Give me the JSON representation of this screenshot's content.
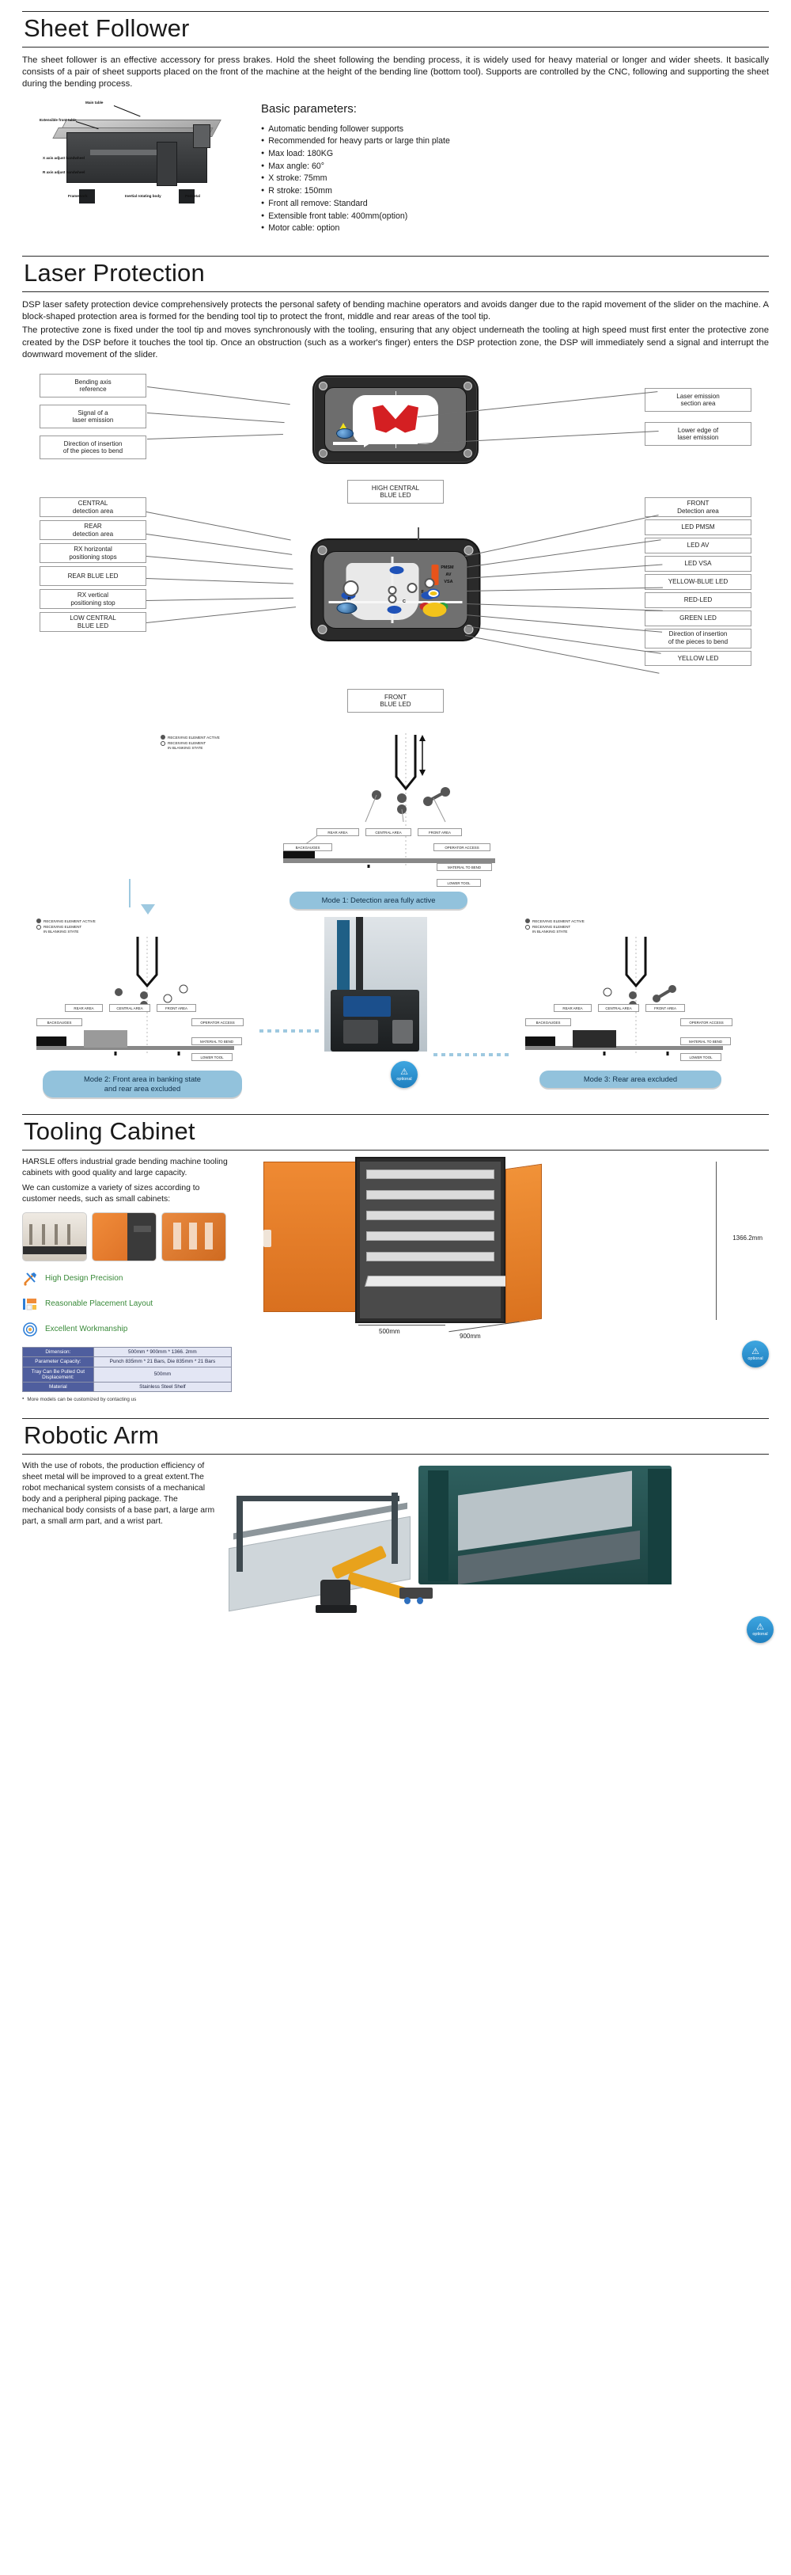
{
  "sections": {
    "sheet_follower": {
      "title": "Sheet Follower",
      "intro": "The sheet follower is an effective accessory for press brakes. Hold the sheet following the bending process, it is widely used for heavy material or longer and wider sheets. It basically consists of a pair of sheet supports placed on the front of the machine at the height of the bending line (bottom tool). Supports are controlled by the CNC, following and supporting the sheet during the bending process.",
      "params_title": "Basic parameters:",
      "params": [
        "Automatic bending follower supports",
        "Recommended for heavy parts or large thin plate",
        "Max load: 180KG",
        "Max angle: 60°",
        "X stroke: 75mm",
        "R stroke: 150mm",
        "Front all remove: Standard",
        "Extensible front table: 400mm(option)",
        "Motor cable: option"
      ],
      "image_labels": {
        "main_table": "Main table",
        "extensible_front_table": "Extensible front table",
        "x_axis": "X axis adjust handwheel",
        "r_axis": "R axis adjust handwheel",
        "framework": "Framework",
        "inertial_rotating_body": "Inertial rotating body",
        "pedestal": "Pedestal"
      }
    },
    "laser_protection": {
      "title": "Laser Protection",
      "paragraph1": "DSP laser safety protection device comprehensively protects the personal safety of bending machine operators and avoids danger due to the rapid movement of the slider on the machine. A block-shaped protection area is formed for the bending tool tip to protect the front, middle and rear areas of the tool tip.",
      "paragraph2": "The protective zone is fixed under the tool tip and moves synchronously with the tooling, ensuring that any object underneath the tooling at high speed must first enter the protective zone created by the DSP before it touches the tool tip. Once an obstruction (such as a worker's finger) enters the DSP protection zone, the DSP will immediately send a signal and interrupt the downward movement of the slider.",
      "diagram1": {
        "left": [
          "Bending axis\nreference",
          "Signal of a\nlaser emission",
          "Direction of insertion\nof the pieces to bend"
        ],
        "right": [
          "Laser emission\nsection area",
          "Lower edge of\nlaser emission"
        ]
      },
      "diagram2": {
        "top": "HIGH CENTRAL\nBLUE LED",
        "bottom": "FRONT\nBLUE LED",
        "left": [
          "CENTRAL\ndetection area",
          "REAR\ndetection area",
          "RX horizontal\npositioning stops",
          "REAR BLUE LED",
          "RX vertical\npositioning stop",
          "LOW CENTRAL\nBLUE LED"
        ],
        "right": [
          "FRONT\nDetection area",
          "LED PMSM",
          "LED AV",
          "LED VSA",
          "YELLOW-BLUE LED",
          "RED-LED",
          "GREEN LED",
          "Direction of insertion\nof the pieces to bend",
          "YELLOW LED"
        ],
        "panel_tags": [
          "PMSM",
          "AV",
          "VSA",
          "R",
          "C",
          "F"
        ]
      },
      "modes": {
        "legend": [
          "RECEIVING ELEMENT ACTIVE",
          "RECEIVING ELEMENT\nIN BLANKING STATE"
        ],
        "zone_labels": [
          "REAR AREA",
          "CENTRAL AREA",
          "FRONT AREA",
          "BACKGAUGES",
          "OPERATOR ACCESS",
          "MATERIAL TO BEND",
          "LOWER TOOL"
        ],
        "captions": [
          "Mode 1: Detection area fully active",
          "Mode 2: Front area in banking state\nand rear area excluded",
          "Mode 3: Rear area excluded"
        ]
      }
    },
    "tooling_cabinet": {
      "title": "Tooling Cabinet",
      "text1": "HARSLE offers industrial grade bending machine tooling cabinets with good quality and large capacity.",
      "text2": "We can customize a variety of sizes according to customer needs, such as small cabinets:",
      "features": [
        {
          "icon": "tools-icon",
          "label": "High Design Precision"
        },
        {
          "icon": "layout-icon",
          "label": "Reasonable Placement Layout"
        },
        {
          "icon": "target-icon",
          "label": "Excellent Workmanship"
        }
      ],
      "spec_rows": [
        {
          "key": "Dimension:",
          "value": "500mm * 900mm * 1366. 2mm"
        },
        {
          "key": "Parameter Capacity:",
          "value": "Punch 835mm * 21 Bars, Die 835mm * 21 Bars"
        },
        {
          "key": "Tray Can Be Pulled Out Displacement:",
          "value": "500mm"
        },
        {
          "key": "Material",
          "value": "Stainless Steel Shelf"
        }
      ],
      "note": "More models can be customized by contacting us",
      "dimensions": {
        "height": "1366.2mm",
        "width": "500mm",
        "depth": "900mm"
      },
      "badge": {
        "line1": "optional"
      }
    },
    "robotic_arm": {
      "title": "Robotic Arm",
      "text": "With the use of robots, the production efficiency of sheet metal will be improved to a great extent.The robot mechanical system consists of a mechanical body and a peripheral piping package. The mechanical body consists of a base part, a large arm part, a small arm part, and a wrist part.",
      "badge": {
        "line1": "optional"
      }
    }
  },
  "colors": {
    "accent_blue": "#92c2dc",
    "brand_orange": "#e8531a",
    "feature_green": "#3a8a3a",
    "table_header": "#4f5e9e",
    "table_cell": "#e3e6f4"
  }
}
